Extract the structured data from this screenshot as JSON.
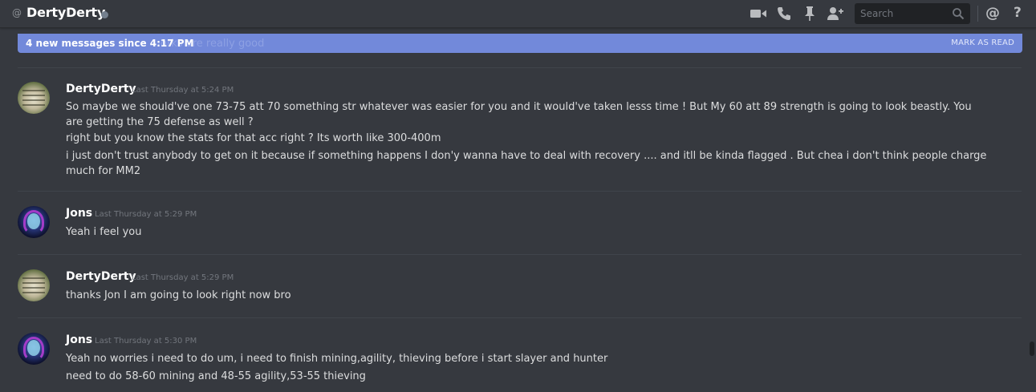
{
  "header": {
    "at_symbol": "@",
    "channel_name": "DertyDerty",
    "icons": [
      "video-icon",
      "phone-icon",
      "pin-icon",
      "add-member-icon",
      "search-icon",
      "mention-icon",
      "help-icon"
    ],
    "search_placeholder": "Search",
    "mention_label": "@",
    "help_label": "?"
  },
  "new_messages_bar": {
    "text": "4 new messages since 4:17 PM",
    "ghost_text": "orks are really good",
    "mark_as_read": "MARK AS READ"
  },
  "messages": [
    {
      "author": "DertyDerty",
      "timestamp": "Last Thursday at 5:24 PM",
      "lines": [
        "So maybe we should've one 73-75 att 70 something str whatever was easier for you and it would've taken lesss time ! But My 60 att 89 strength is going to look beastly. You are getting the 75 defense as well ?",
        "right but you know the stats for that acc right ? Its worth like 300-400m",
        "i just don't trust anybody to get on it because if something happens I don'y wanna have to deal with recovery .... and itll be kinda flagged . But chea i don't think people charge much for MM2"
      ]
    },
    {
      "author": "Jons",
      "timestamp": "Last Thursday at 5:29 PM",
      "lines": [
        "Yeah i feel you"
      ]
    },
    {
      "author": "DertyDerty",
      "timestamp": "Last Thursday at 5:29 PM",
      "lines": [
        "thanks Jon I am going to look right now bro"
      ]
    },
    {
      "author": "Jons",
      "timestamp": "Last Thursday at 5:30 PM",
      "lines": [
        "Yeah no worries i need to do um, i need to finish mining,agility, thieving before i start slayer and hunter",
        "need to do 58-60 mining and 48-55 agility,53-55 thieving"
      ]
    }
  ],
  "colors": {
    "background": "#36393f",
    "accent": "#7289da",
    "search_bg": "#202225",
    "status_offline": "#747f8d"
  }
}
